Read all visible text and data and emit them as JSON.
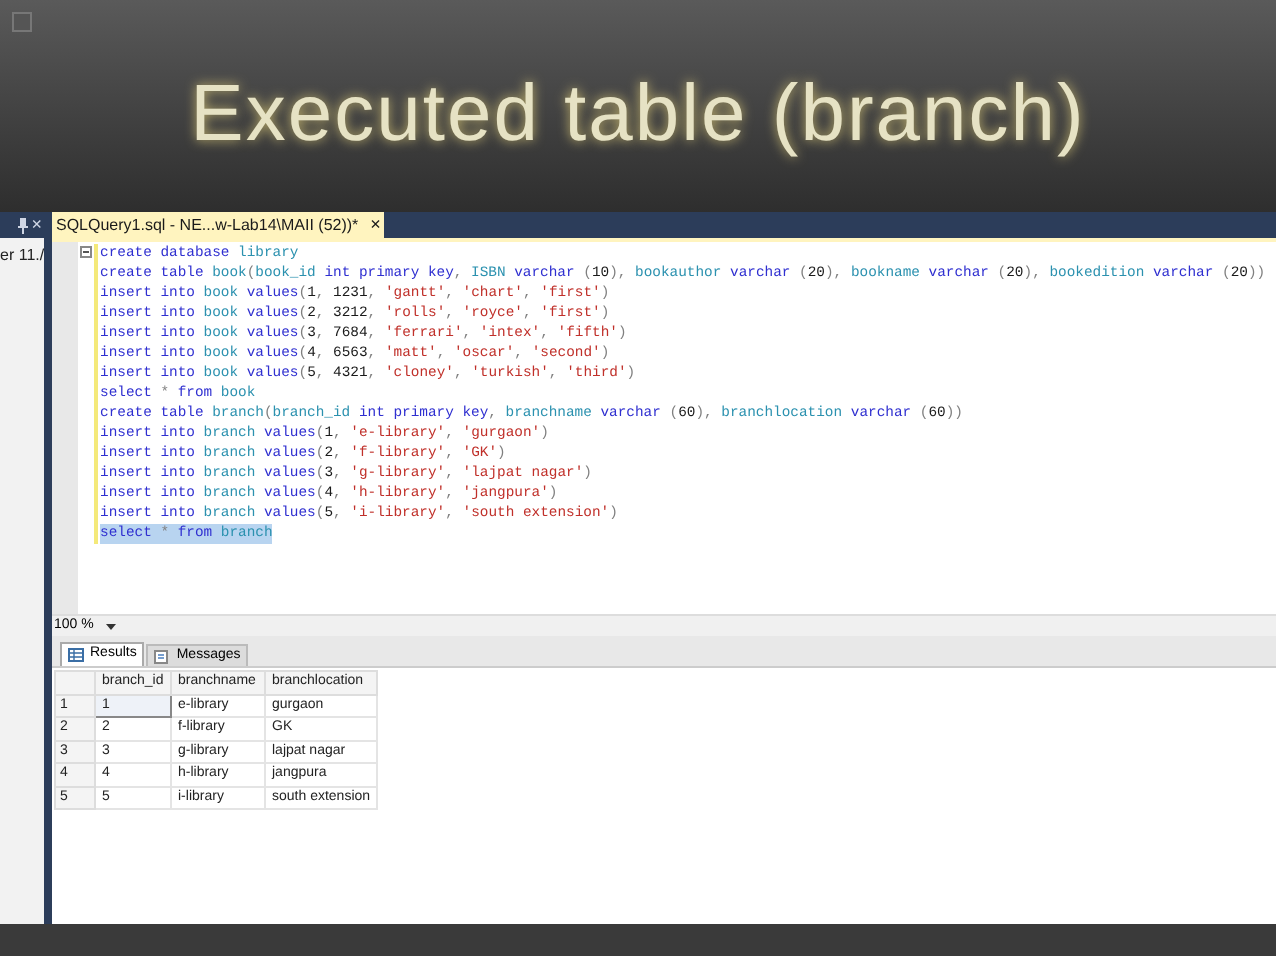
{
  "slide": {
    "title": "Executed table (branch)"
  },
  "left_pane": {
    "close": "×",
    "text": "er 11./"
  },
  "editor_tab": {
    "title": "SQLQuery1.sql - NE...w-Lab14\\MAII (52))*",
    "close": "×"
  },
  "code_lines": [
    {
      "selected": false,
      "tokens": [
        {
          "kind": "kw",
          "text": "create database "
        },
        {
          "kind": "id",
          "text": "library"
        }
      ]
    },
    {
      "selected": false,
      "tokens": [
        {
          "kind": "kw",
          "text": "create table "
        },
        {
          "kind": "id",
          "text": "book"
        },
        {
          "kind": "p",
          "text": "("
        },
        {
          "kind": "id",
          "text": "book_id "
        },
        {
          "kind": "kw",
          "text": "int primary key"
        },
        {
          "kind": "p",
          "text": ", "
        },
        {
          "kind": "id",
          "text": "ISBN "
        },
        {
          "kind": "kw",
          "text": "varchar "
        },
        {
          "kind": "p",
          "text": "("
        },
        {
          "kind": "num",
          "text": "10"
        },
        {
          "kind": "p",
          "text": "), "
        },
        {
          "kind": "id",
          "text": "bookauthor "
        },
        {
          "kind": "kw",
          "text": "varchar "
        },
        {
          "kind": "p",
          "text": "("
        },
        {
          "kind": "num",
          "text": "20"
        },
        {
          "kind": "p",
          "text": "), "
        },
        {
          "kind": "id",
          "text": "bookname "
        },
        {
          "kind": "kw",
          "text": "varchar "
        },
        {
          "kind": "p",
          "text": "("
        },
        {
          "kind": "num",
          "text": "20"
        },
        {
          "kind": "p",
          "text": "), "
        },
        {
          "kind": "id",
          "text": "bookedition "
        },
        {
          "kind": "kw",
          "text": "varchar "
        },
        {
          "kind": "p",
          "text": "("
        },
        {
          "kind": "num",
          "text": "20"
        },
        {
          "kind": "p",
          "text": "))"
        }
      ]
    },
    {
      "selected": false,
      "tokens": [
        {
          "kind": "kw",
          "text": "insert into "
        },
        {
          "kind": "id",
          "text": "book "
        },
        {
          "kind": "kw",
          "text": "values"
        },
        {
          "kind": "p",
          "text": "("
        },
        {
          "kind": "num",
          "text": "1"
        },
        {
          "kind": "p",
          "text": ", "
        },
        {
          "kind": "num",
          "text": "1231"
        },
        {
          "kind": "p",
          "text": ", "
        },
        {
          "kind": "str",
          "text": "'gantt'"
        },
        {
          "kind": "p",
          "text": ", "
        },
        {
          "kind": "str",
          "text": "'chart'"
        },
        {
          "kind": "p",
          "text": ", "
        },
        {
          "kind": "str",
          "text": "'first'"
        },
        {
          "kind": "p",
          "text": ")"
        }
      ]
    },
    {
      "selected": false,
      "tokens": [
        {
          "kind": "kw",
          "text": "insert into "
        },
        {
          "kind": "id",
          "text": "book "
        },
        {
          "kind": "kw",
          "text": "values"
        },
        {
          "kind": "p",
          "text": "("
        },
        {
          "kind": "num",
          "text": "2"
        },
        {
          "kind": "p",
          "text": ", "
        },
        {
          "kind": "num",
          "text": "3212"
        },
        {
          "kind": "p",
          "text": ", "
        },
        {
          "kind": "str",
          "text": "'rolls'"
        },
        {
          "kind": "p",
          "text": ", "
        },
        {
          "kind": "str",
          "text": "'royce'"
        },
        {
          "kind": "p",
          "text": ", "
        },
        {
          "kind": "str",
          "text": "'first'"
        },
        {
          "kind": "p",
          "text": ")"
        }
      ]
    },
    {
      "selected": false,
      "tokens": [
        {
          "kind": "kw",
          "text": "insert into "
        },
        {
          "kind": "id",
          "text": "book "
        },
        {
          "kind": "kw",
          "text": "values"
        },
        {
          "kind": "p",
          "text": "("
        },
        {
          "kind": "num",
          "text": "3"
        },
        {
          "kind": "p",
          "text": ", "
        },
        {
          "kind": "num",
          "text": "7684"
        },
        {
          "kind": "p",
          "text": ", "
        },
        {
          "kind": "str",
          "text": "'ferrari'"
        },
        {
          "kind": "p",
          "text": ", "
        },
        {
          "kind": "str",
          "text": "'intex'"
        },
        {
          "kind": "p",
          "text": ", "
        },
        {
          "kind": "str",
          "text": "'fifth'"
        },
        {
          "kind": "p",
          "text": ")"
        }
      ]
    },
    {
      "selected": false,
      "tokens": [
        {
          "kind": "kw",
          "text": "insert into "
        },
        {
          "kind": "id",
          "text": "book "
        },
        {
          "kind": "kw",
          "text": "values"
        },
        {
          "kind": "p",
          "text": "("
        },
        {
          "kind": "num",
          "text": "4"
        },
        {
          "kind": "p",
          "text": ", "
        },
        {
          "kind": "num",
          "text": "6563"
        },
        {
          "kind": "p",
          "text": ", "
        },
        {
          "kind": "str",
          "text": "'matt'"
        },
        {
          "kind": "p",
          "text": ", "
        },
        {
          "kind": "str",
          "text": "'oscar'"
        },
        {
          "kind": "p",
          "text": ", "
        },
        {
          "kind": "str",
          "text": "'second'"
        },
        {
          "kind": "p",
          "text": ")"
        }
      ]
    },
    {
      "selected": false,
      "tokens": [
        {
          "kind": "kw",
          "text": "insert into "
        },
        {
          "kind": "id",
          "text": "book "
        },
        {
          "kind": "kw",
          "text": "values"
        },
        {
          "kind": "p",
          "text": "("
        },
        {
          "kind": "num",
          "text": "5"
        },
        {
          "kind": "p",
          "text": ", "
        },
        {
          "kind": "num",
          "text": "4321"
        },
        {
          "kind": "p",
          "text": ", "
        },
        {
          "kind": "str",
          "text": "'cloney'"
        },
        {
          "kind": "p",
          "text": ", "
        },
        {
          "kind": "str",
          "text": "'turkish'"
        },
        {
          "kind": "p",
          "text": ", "
        },
        {
          "kind": "str",
          "text": "'third'"
        },
        {
          "kind": "p",
          "text": ")"
        }
      ]
    },
    {
      "selected": false,
      "tokens": [
        {
          "kind": "kw",
          "text": "select "
        },
        {
          "kind": "p",
          "text": "* "
        },
        {
          "kind": "kw",
          "text": "from "
        },
        {
          "kind": "id",
          "text": "book"
        }
      ]
    },
    {
      "selected": false,
      "tokens": [
        {
          "kind": "kw",
          "text": "create table "
        },
        {
          "kind": "id",
          "text": "branch"
        },
        {
          "kind": "p",
          "text": "("
        },
        {
          "kind": "id",
          "text": "branch_id "
        },
        {
          "kind": "kw",
          "text": "int primary key"
        },
        {
          "kind": "p",
          "text": ", "
        },
        {
          "kind": "id",
          "text": "branchname "
        },
        {
          "kind": "kw",
          "text": "varchar "
        },
        {
          "kind": "p",
          "text": "("
        },
        {
          "kind": "num",
          "text": "60"
        },
        {
          "kind": "p",
          "text": "), "
        },
        {
          "kind": "id",
          "text": "branchlocation "
        },
        {
          "kind": "kw",
          "text": "varchar "
        },
        {
          "kind": "p",
          "text": "("
        },
        {
          "kind": "num",
          "text": "60"
        },
        {
          "kind": "p",
          "text": "))"
        }
      ]
    },
    {
      "selected": false,
      "tokens": [
        {
          "kind": "kw",
          "text": "insert into "
        },
        {
          "kind": "id",
          "text": "branch "
        },
        {
          "kind": "kw",
          "text": "values"
        },
        {
          "kind": "p",
          "text": "("
        },
        {
          "kind": "num",
          "text": "1"
        },
        {
          "kind": "p",
          "text": ", "
        },
        {
          "kind": "str",
          "text": "'e-library'"
        },
        {
          "kind": "p",
          "text": ", "
        },
        {
          "kind": "str",
          "text": "'gurgaon'"
        },
        {
          "kind": "p",
          "text": ")"
        }
      ]
    },
    {
      "selected": false,
      "tokens": [
        {
          "kind": "kw",
          "text": "insert into "
        },
        {
          "kind": "id",
          "text": "branch "
        },
        {
          "kind": "kw",
          "text": "values"
        },
        {
          "kind": "p",
          "text": "("
        },
        {
          "kind": "num",
          "text": "2"
        },
        {
          "kind": "p",
          "text": ", "
        },
        {
          "kind": "str",
          "text": "'f-library'"
        },
        {
          "kind": "p",
          "text": ", "
        },
        {
          "kind": "str",
          "text": "'GK'"
        },
        {
          "kind": "p",
          "text": ")"
        }
      ]
    },
    {
      "selected": false,
      "tokens": [
        {
          "kind": "kw",
          "text": "insert into "
        },
        {
          "kind": "id",
          "text": "branch "
        },
        {
          "kind": "kw",
          "text": "values"
        },
        {
          "kind": "p",
          "text": "("
        },
        {
          "kind": "num",
          "text": "3"
        },
        {
          "kind": "p",
          "text": ", "
        },
        {
          "kind": "str",
          "text": "'g-library'"
        },
        {
          "kind": "p",
          "text": ", "
        },
        {
          "kind": "str",
          "text": "'lajpat nagar'"
        },
        {
          "kind": "p",
          "text": ")"
        }
      ]
    },
    {
      "selected": false,
      "tokens": [
        {
          "kind": "kw",
          "text": "insert into "
        },
        {
          "kind": "id",
          "text": "branch "
        },
        {
          "kind": "kw",
          "text": "values"
        },
        {
          "kind": "p",
          "text": "("
        },
        {
          "kind": "num",
          "text": "4"
        },
        {
          "kind": "p",
          "text": ", "
        },
        {
          "kind": "str",
          "text": "'h-library'"
        },
        {
          "kind": "p",
          "text": ", "
        },
        {
          "kind": "str",
          "text": "'jangpura'"
        },
        {
          "kind": "p",
          "text": ")"
        }
      ]
    },
    {
      "selected": false,
      "tokens": [
        {
          "kind": "kw",
          "text": "insert into "
        },
        {
          "kind": "id",
          "text": "branch "
        },
        {
          "kind": "kw",
          "text": "values"
        },
        {
          "kind": "p",
          "text": "("
        },
        {
          "kind": "num",
          "text": "5"
        },
        {
          "kind": "p",
          "text": ", "
        },
        {
          "kind": "str",
          "text": "'i-library'"
        },
        {
          "kind": "p",
          "text": ", "
        },
        {
          "kind": "str",
          "text": "'south extension'"
        },
        {
          "kind": "p",
          "text": ")"
        }
      ]
    },
    {
      "selected": true,
      "tokens": [
        {
          "kind": "kw",
          "text": "select "
        },
        {
          "kind": "p",
          "text": "* "
        },
        {
          "kind": "kw",
          "text": "from "
        },
        {
          "kind": "id",
          "text": "branch"
        }
      ]
    }
  ],
  "zoom": {
    "value": "100 %"
  },
  "result_tabs": [
    {
      "label": "Results",
      "selected": true
    },
    {
      "label": "Messages",
      "selected": false
    }
  ],
  "table": {
    "columns": [
      "branch_id",
      "branchname",
      "branchlocation"
    ],
    "rows": [
      {
        "number": "1",
        "cells": [
          "1",
          "e-library",
          "gurgaon"
        ]
      },
      {
        "number": "2",
        "cells": [
          "2",
          "f-library",
          "GK"
        ]
      },
      {
        "number": "3",
        "cells": [
          "3",
          "g-library",
          "lajpat nagar"
        ]
      },
      {
        "number": "4",
        "cells": [
          "4",
          "h-library",
          "jangpura"
        ]
      },
      {
        "number": "5",
        "cells": [
          "5",
          "i-library",
          "south extension"
        ]
      }
    ]
  }
}
